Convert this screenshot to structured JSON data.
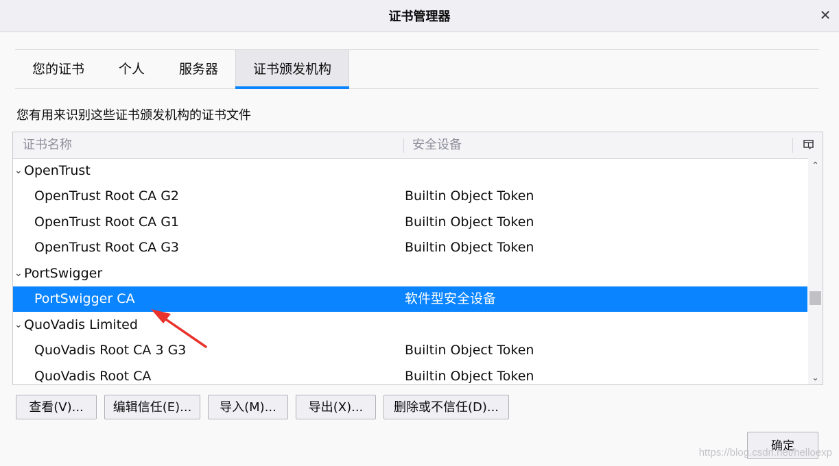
{
  "window": {
    "title": "证书管理器",
    "close_label": "✕"
  },
  "tabs": [
    {
      "label": "您的证书",
      "selected": false
    },
    {
      "label": "个人",
      "selected": false
    },
    {
      "label": "服务器",
      "selected": false
    },
    {
      "label": "证书颁发机构",
      "selected": true
    }
  ],
  "description": "您有用来识别这些证书颁发机构的证书文件",
  "tree": {
    "columns": {
      "name": "证书名称",
      "device": "安全设备"
    },
    "rows": [
      {
        "type": "group",
        "name": "OpenTrust",
        "device": ""
      },
      {
        "type": "item",
        "name": "OpenTrust Root CA G2",
        "device": "Builtin Object Token"
      },
      {
        "type": "item",
        "name": "OpenTrust Root CA G1",
        "device": "Builtin Object Token"
      },
      {
        "type": "item",
        "name": "OpenTrust Root CA G3",
        "device": "Builtin Object Token"
      },
      {
        "type": "group",
        "name": "PortSwigger",
        "device": ""
      },
      {
        "type": "item",
        "name": "PortSwigger CA",
        "device": "软件型安全设备",
        "selected": true
      },
      {
        "type": "group",
        "name": "QuoVadis Limited",
        "device": ""
      },
      {
        "type": "item",
        "name": "QuoVadis Root CA 3 G3",
        "device": "Builtin Object Token"
      },
      {
        "type": "item",
        "name": "QuoVadis Root CA",
        "device": "Builtin Object Token"
      }
    ]
  },
  "buttons": {
    "view": "查看(V)...",
    "edit_trust": "编辑信任(E)...",
    "import": "导入(M)...",
    "export": "导出(X)...",
    "delete": "删除或不信任(D)..."
  },
  "ok_label": "确定",
  "watermark": "https://blog.csdn.net/helloexp",
  "colors": {
    "accent": "#0a84ff",
    "selection": "#0a84ff",
    "annotation_arrow": "#e8322b"
  }
}
